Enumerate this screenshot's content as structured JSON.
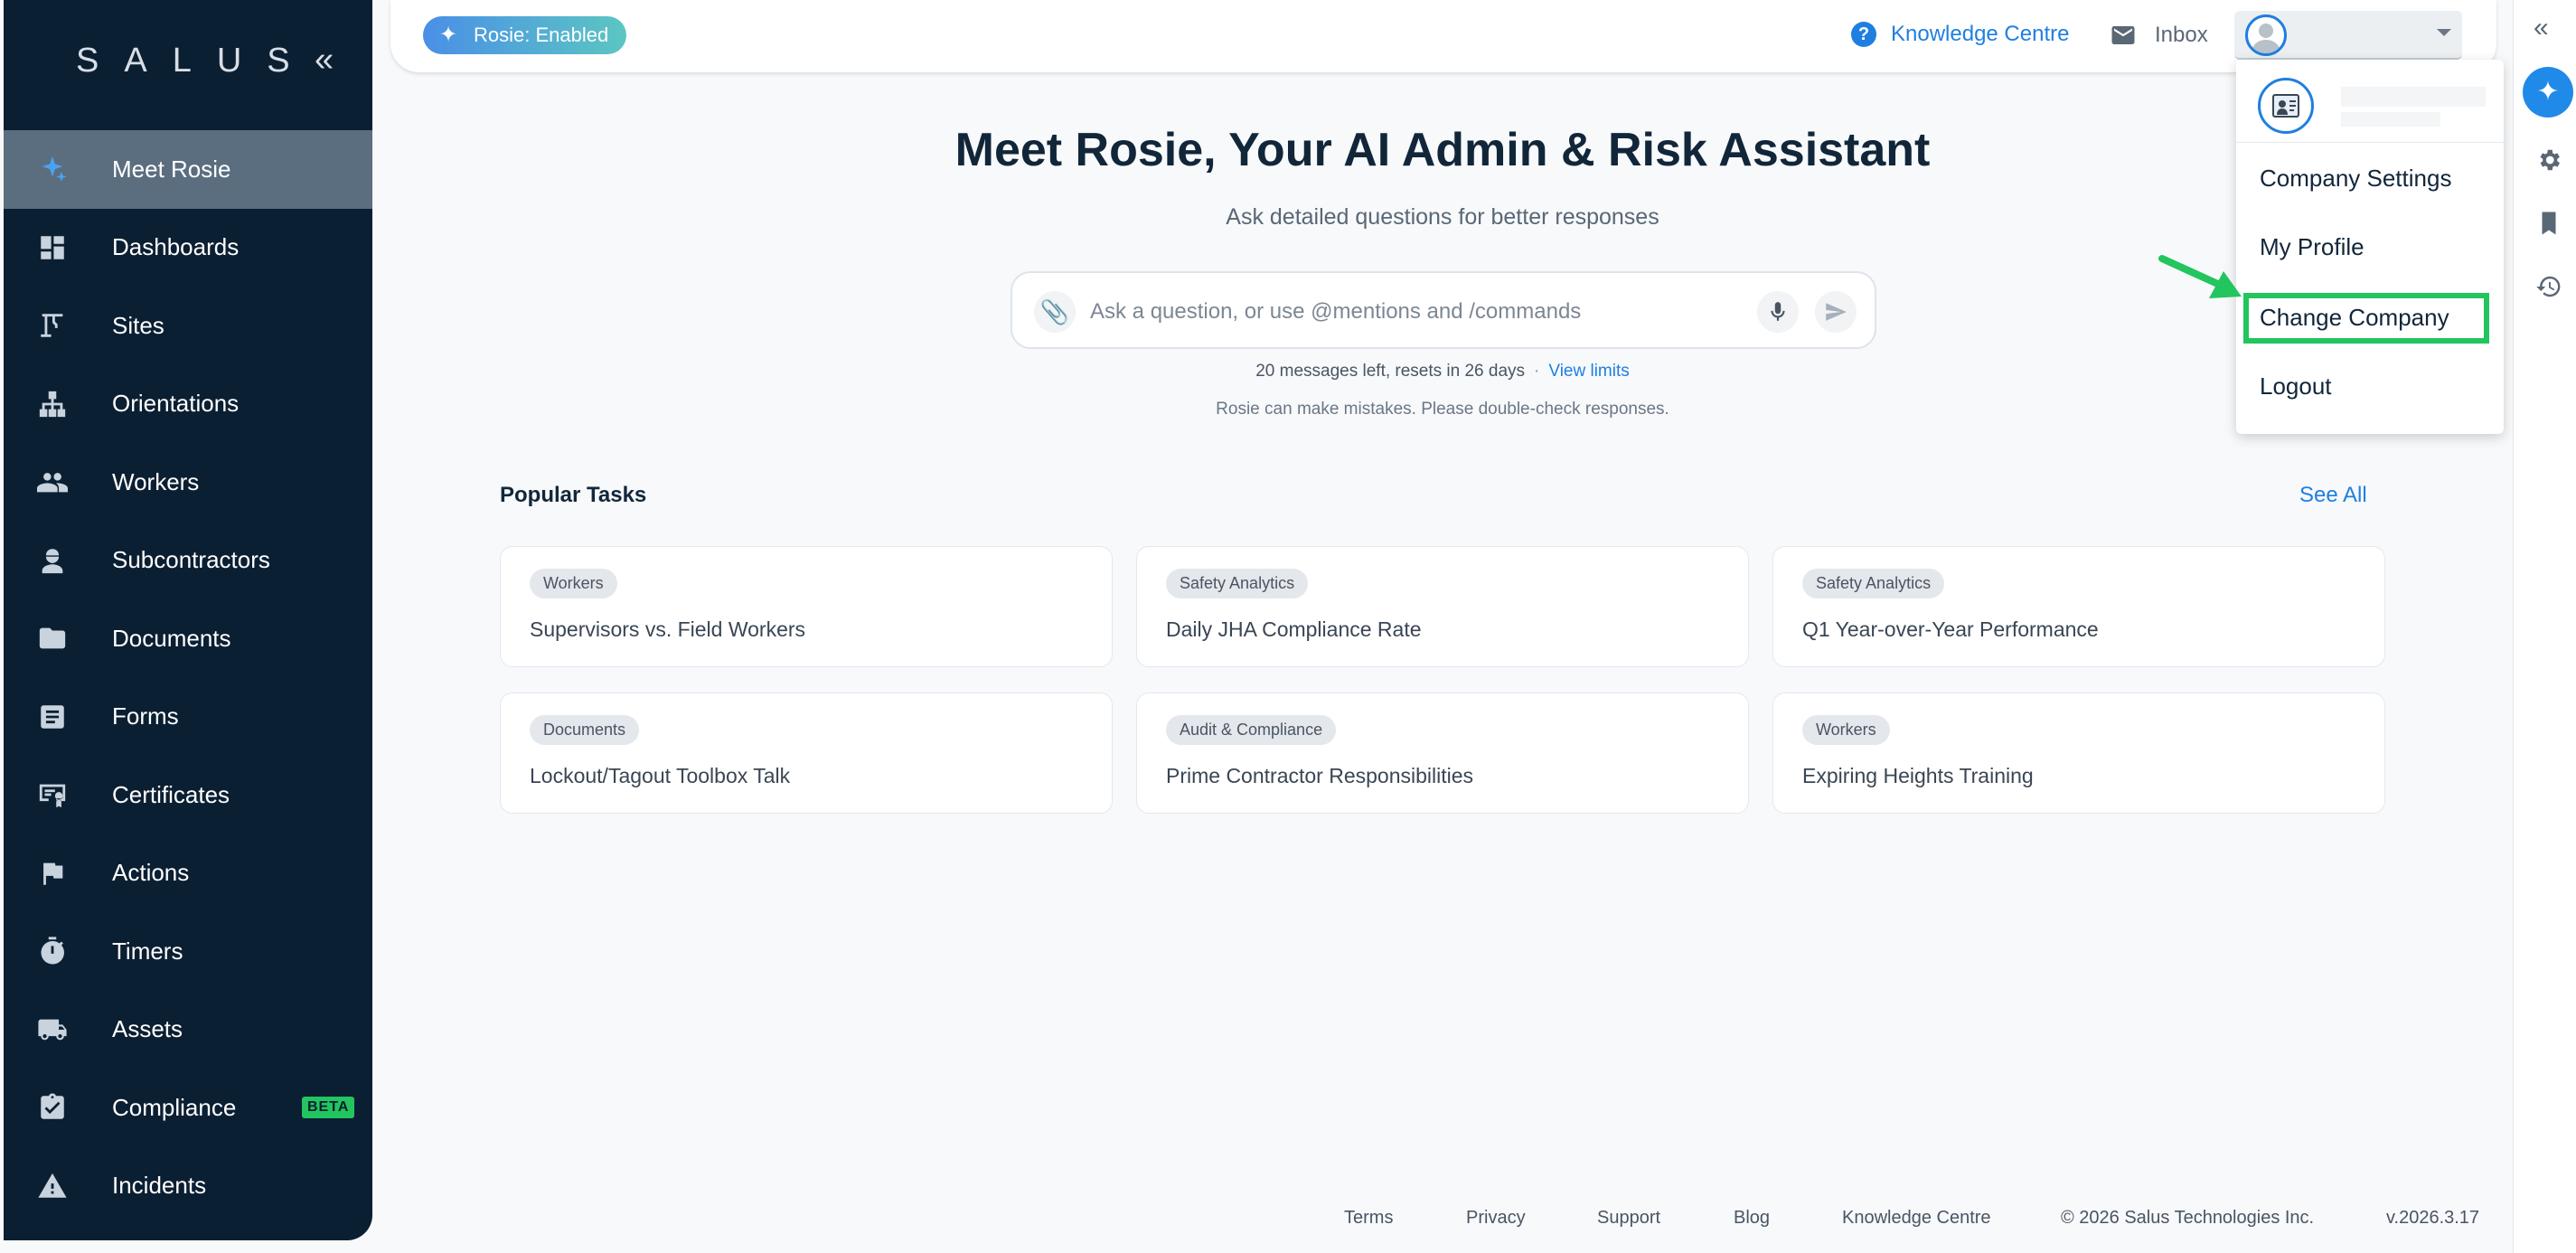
{
  "sidebar": {
    "logo": "SALUS",
    "collapse": "«",
    "items": [
      {
        "label": "Meet Rosie"
      },
      {
        "label": "Dashboards"
      },
      {
        "label": "Sites"
      },
      {
        "label": "Orientations"
      },
      {
        "label": "Workers"
      },
      {
        "label": "Subcontractors"
      },
      {
        "label": "Documents"
      },
      {
        "label": "Forms"
      },
      {
        "label": "Certificates"
      },
      {
        "label": "Actions"
      },
      {
        "label": "Timers"
      },
      {
        "label": "Assets"
      },
      {
        "label": "Compliance",
        "badge": "BETA"
      },
      {
        "label": "Incidents"
      }
    ]
  },
  "header": {
    "rosie_pill": "Rosie: Enabled",
    "knowledge_centre": "Knowledge Centre",
    "inbox": "Inbox"
  },
  "rail": {
    "expand": "«"
  },
  "main": {
    "title": "Meet Rosie, Your AI Admin & Risk Assistant",
    "subtitle": "Ask detailed questions for better responses",
    "input_placeholder": "Ask a question, or use @mentions and /commands",
    "limits_text": "20 messages left, resets in 26 days",
    "limits_sep": "·",
    "view_limits": "View limits",
    "disclaimer": "Rosie can make mistakes. Please double-check responses.",
    "popular_title": "Popular Tasks",
    "see_all": "See All",
    "tasks": [
      {
        "tag": "Workers",
        "title": "Supervisors vs. Field Workers"
      },
      {
        "tag": "Safety Analytics",
        "title": "Daily JHA Compliance Rate"
      },
      {
        "tag": "Safety Analytics",
        "title": "Q1 Year-over-Year Performance"
      },
      {
        "tag": "Documents",
        "title": "Lockout/Tagout Toolbox Talk"
      },
      {
        "tag": "Audit & Compliance",
        "title": "Prime Contractor Responsibilities"
      },
      {
        "tag": "Workers",
        "title": "Expiring Heights Training"
      }
    ]
  },
  "dropdown": {
    "items": [
      {
        "label": "Company Settings"
      },
      {
        "label": "My Profile"
      },
      {
        "label": "Change Company"
      },
      {
        "label": "Logout"
      }
    ]
  },
  "footer": {
    "links": [
      "Terms",
      "Privacy",
      "Support",
      "Blog",
      "Knowledge Centre"
    ],
    "copyright": "© 2026 Salus Technologies Inc.",
    "version": "v.2026.3.17"
  },
  "colors": {
    "sidebar_bg": "#0b1f33",
    "accent": "#1f7fe0",
    "highlight": "#22c55e"
  }
}
